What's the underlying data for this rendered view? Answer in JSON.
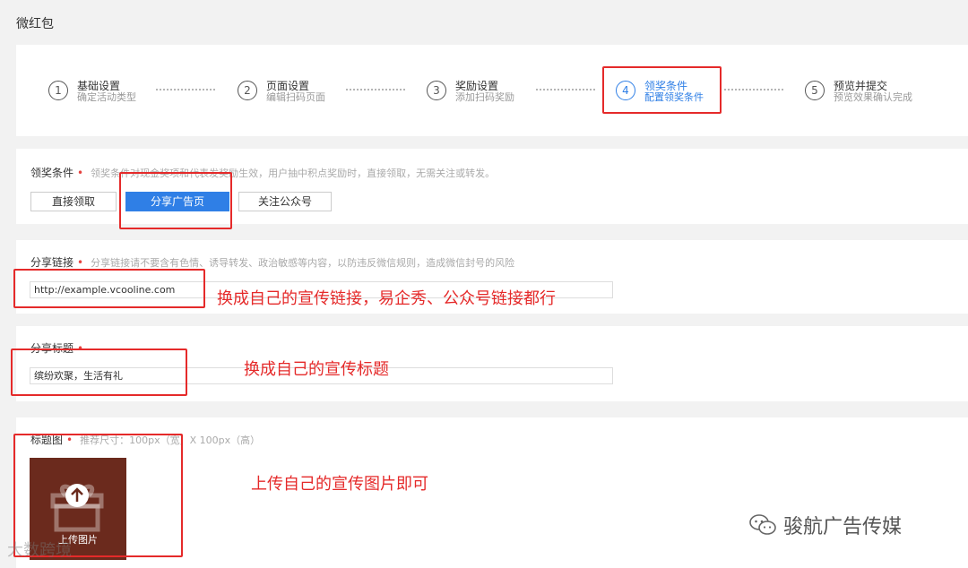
{
  "app": {
    "title": "微红包"
  },
  "steps": [
    {
      "num": "1",
      "title": "基础设置",
      "sub": "确定活动类型"
    },
    {
      "num": "2",
      "title": "页面设置",
      "sub": "编辑扫码页面"
    },
    {
      "num": "3",
      "title": "奖励设置",
      "sub": "添加扫码奖励"
    },
    {
      "num": "4",
      "title": "领奖条件",
      "sub": "配置领奖条件"
    },
    {
      "num": "5",
      "title": "预览并提交",
      "sub": "预览效果确认完成"
    }
  ],
  "active_step": 4,
  "condition": {
    "label": "领奖条件",
    "required": "•",
    "hint": "领奖条件对现金奖项和代表发奖励生效，用户抽中积点奖励时，直接领取，无需关注或转发。",
    "options": [
      "直接领取",
      "分享广告页",
      "关注公众号"
    ],
    "selected": "分享广告页"
  },
  "share_link": {
    "label": "分享链接",
    "required": "•",
    "hint": "分享链接请不要含有色情、诱导转发、政治敏感等内容，以防违反微信规则，造成微信封号的风险",
    "value": "http://example.vcooline.com"
  },
  "share_title": {
    "label": "分享标题",
    "required": "•",
    "value": "缤纷欢聚，生活有礼"
  },
  "title_image": {
    "label": "标题图",
    "required": "•",
    "hint": "推荐尺寸：100px（宽）X 100px（高）",
    "upload_label": "上传图片"
  },
  "annotations": {
    "link": "换成自己的宣传链接，易企秀、公众号链接都行",
    "title": "换成自己的宣传标题",
    "image": "上传自己的宣传图片即可"
  },
  "watermarks": {
    "left": "大数跨境",
    "right": "骏航广告传媒"
  },
  "colors": {
    "accent": "#2f7fe6",
    "annotation": "#e52a2a"
  }
}
